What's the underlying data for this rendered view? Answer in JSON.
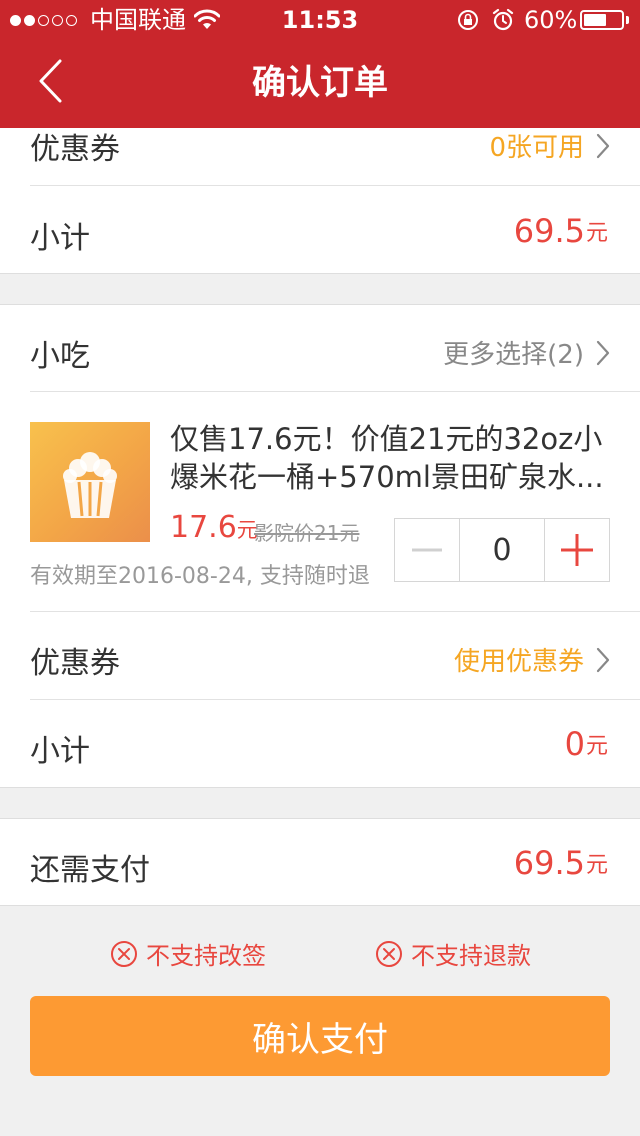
{
  "status_bar": {
    "carrier": "中国联通",
    "time": "11:53",
    "battery_percent_label": "60%",
    "battery_level": 0.6,
    "signal_dots_filled": 2,
    "signal_dots_total": 5,
    "icons": [
      "wifi-icon",
      "rotation-lock-icon",
      "alarm-icon",
      "battery-icon"
    ]
  },
  "nav": {
    "title": "确认订单",
    "back_icon": "chevron-left-icon"
  },
  "ticket_section": {
    "coupon": {
      "label": "优惠券",
      "value": "0张可用"
    },
    "subtotal": {
      "label": "小计",
      "amount": "69.5",
      "unit": "元"
    }
  },
  "snack_section": {
    "header": {
      "label": "小吃",
      "more": "更多选择(2)"
    },
    "item": {
      "thumbnail_icon": "popcorn-icon",
      "title": "仅售17.6元！价值21元的32oz小爆米花一桶+570ml景田矿泉水...",
      "price": "17.6",
      "price_unit": "元",
      "original_price": "影院价21元",
      "validity": "有效期至2016-08-24, 支持随时退",
      "quantity": "0"
    },
    "coupon": {
      "label": "优惠券",
      "value": "使用优惠券"
    },
    "subtotal": {
      "label": "小计",
      "amount": "0",
      "unit": "元"
    }
  },
  "payment": {
    "label": "还需支付",
    "amount": "69.5",
    "unit": "元"
  },
  "notices": [
    "不支持改签",
    "不支持退款"
  ],
  "confirm_button": "确认支付",
  "colors": {
    "header_red": "#c9262c",
    "price_red": "#e8473f",
    "coupon_orange": "#f5a623",
    "button_orange": "#fd9a33",
    "background": "#f0f0f0"
  }
}
